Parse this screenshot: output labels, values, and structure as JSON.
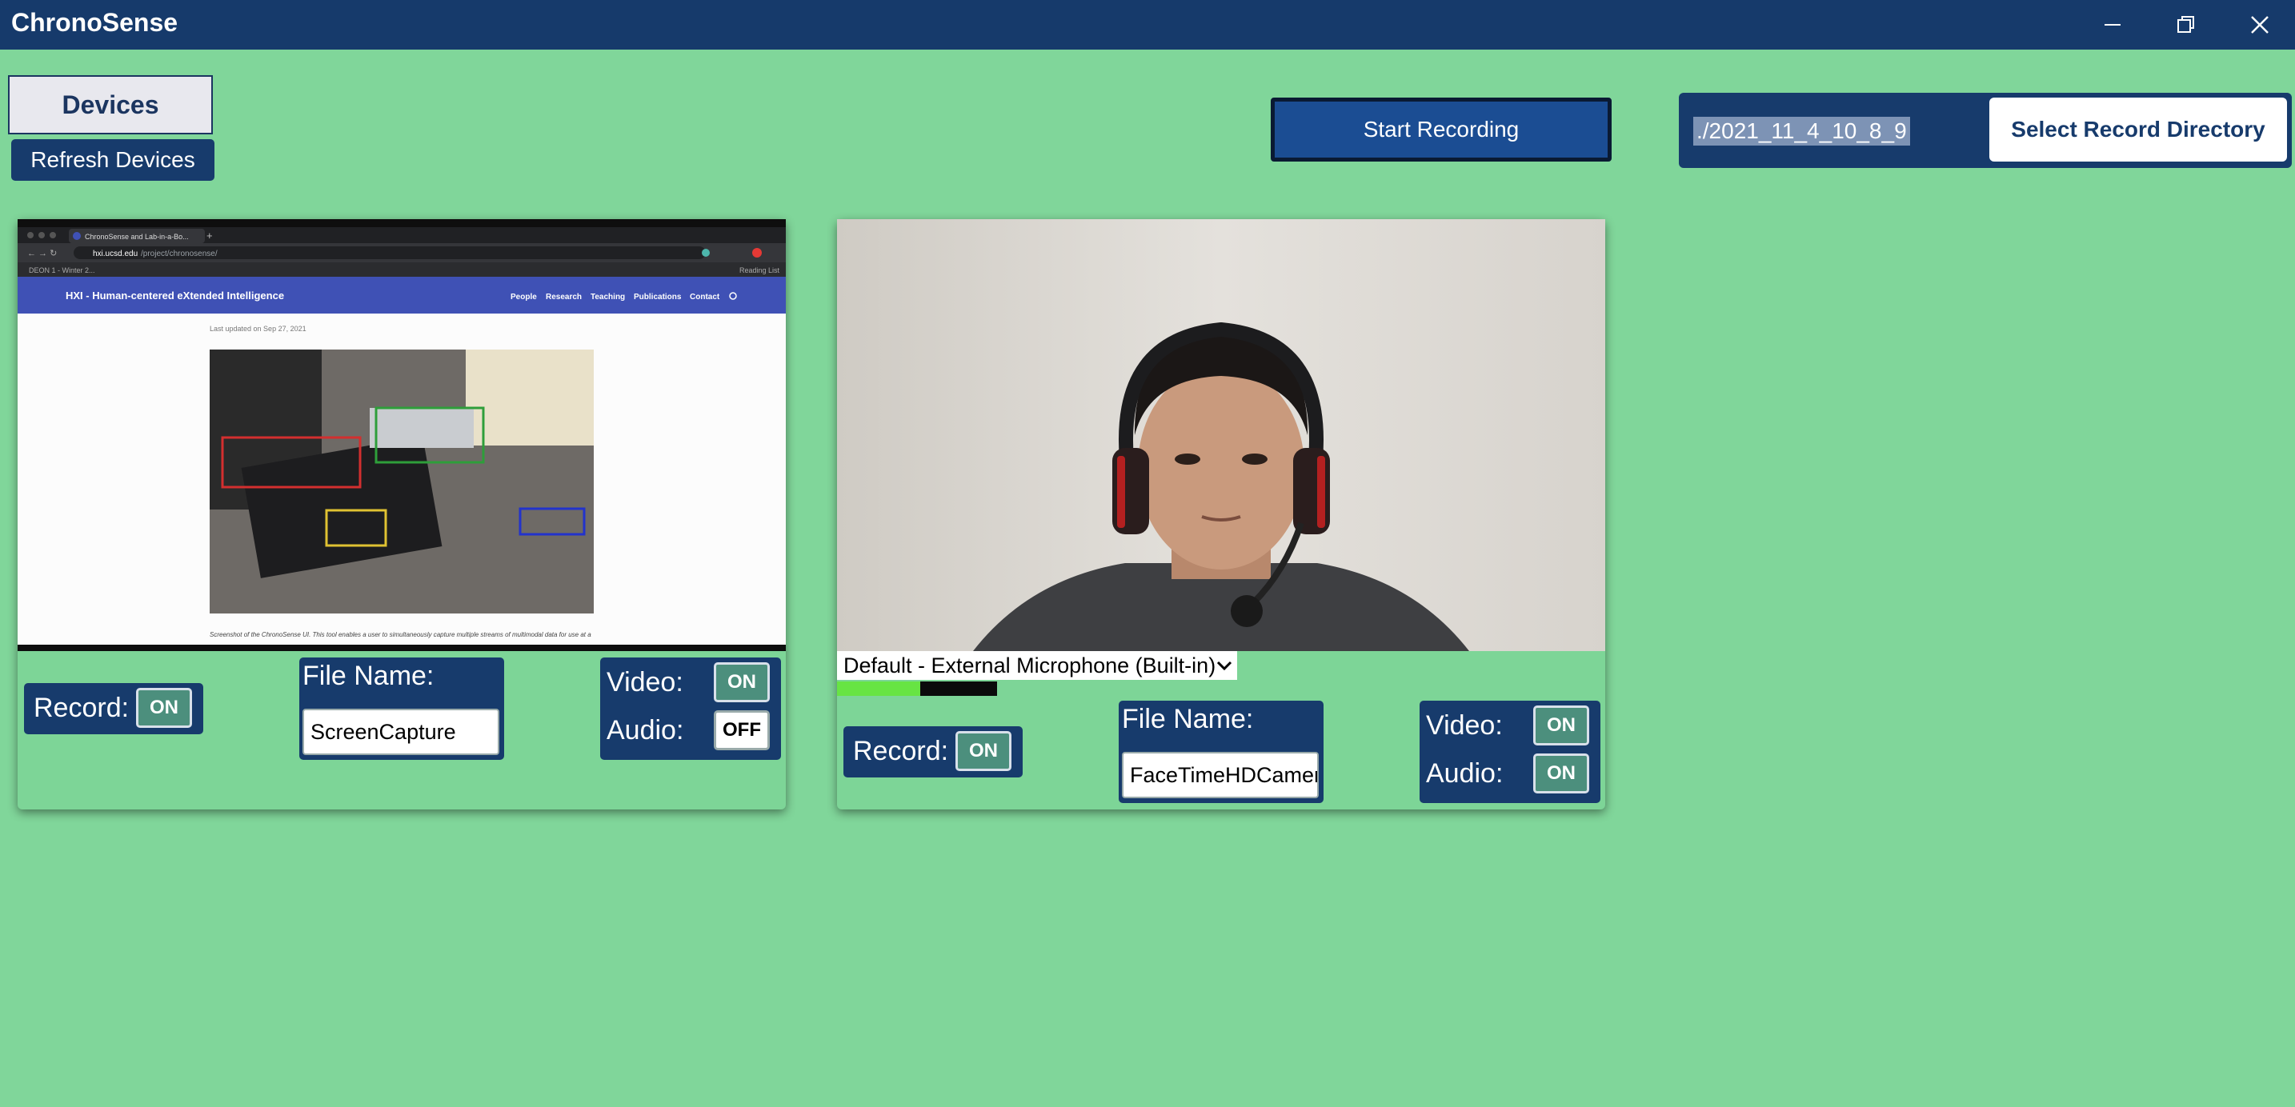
{
  "titlebar": {
    "title": "ChronoSense",
    "controls": [
      "minimize-icon",
      "restore-icon",
      "close-icon"
    ]
  },
  "toolbar": {
    "devices_label": "Devices",
    "refresh_label": "Refresh Devices",
    "start_recording_label": "Start Recording",
    "record_directory_value": "./2021_11_4_10_8_9",
    "select_directory_label": "Select Record Directory"
  },
  "devices": [
    {
      "preview": {
        "tab_title": "ChronoSense and Lab-in-a-Bo...",
        "url_domain": "hxi.ucsd.edu",
        "url_path": "/project/chronosense/",
        "bookmark": "DEON 1 - Winter 2...",
        "reading_list": "Reading List",
        "site_title": "HXI - Human-centered eXtended Intelligence",
        "nav": [
          "People",
          "Research",
          "Teaching",
          "Publications",
          "Contact"
        ],
        "updated": "Last updated on Sep 27, 2021",
        "caption": "Screenshot of the ChronoSense UI. This tool enables a user to simultaneously capture multiple streams of multimodal data for use at a"
      },
      "record_label": "Record:",
      "record_state": "ON",
      "file_name_label": "File Name:",
      "file_name": "ScreenCapture",
      "video_label": "Video:",
      "video_state": "ON",
      "audio_label": "Audio:",
      "audio_state": "OFF"
    },
    {
      "microphone": "Default - External Microphone (Built-in)",
      "audio_level": 0.52,
      "record_label": "Record:",
      "record_state": "ON",
      "file_name_label": "File Name:",
      "file_name": "FaceTimeHDCamera",
      "video_label": "Video:",
      "video_state": "ON",
      "audio_label": "Audio:",
      "audio_state": "ON"
    }
  ],
  "colors": {
    "background": "#80d69a",
    "panel_blue": "#173b6c",
    "toggle_on": "#4c8f7d",
    "meter_green": "#67e443"
  }
}
